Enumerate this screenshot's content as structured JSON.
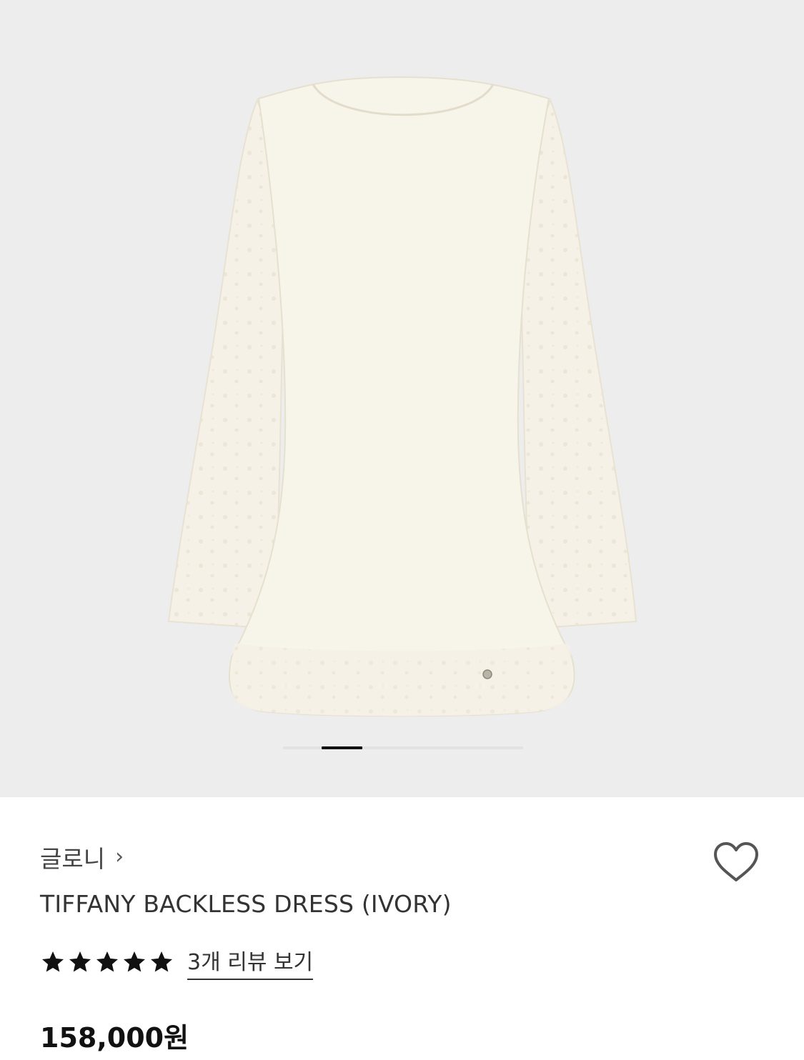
{
  "product": {
    "brand": "글로니",
    "brand_chevron": "›",
    "title": "TIFFANY BACKLESS DRESS (IVORY)",
    "rating_stars": 5,
    "review_link": "3개 리뷰 보기",
    "price": "158,000원"
  },
  "carousel": {
    "current_slide": 1
  },
  "icons": {
    "brand_chevron": "chevron-right-icon",
    "wishlist": "heart-outline-icon",
    "rating": "star-filled-icon"
  },
  "colors": {
    "hero_background": "#ededed",
    "dress_ivory": "#f6f2e7",
    "star": "#111111"
  }
}
